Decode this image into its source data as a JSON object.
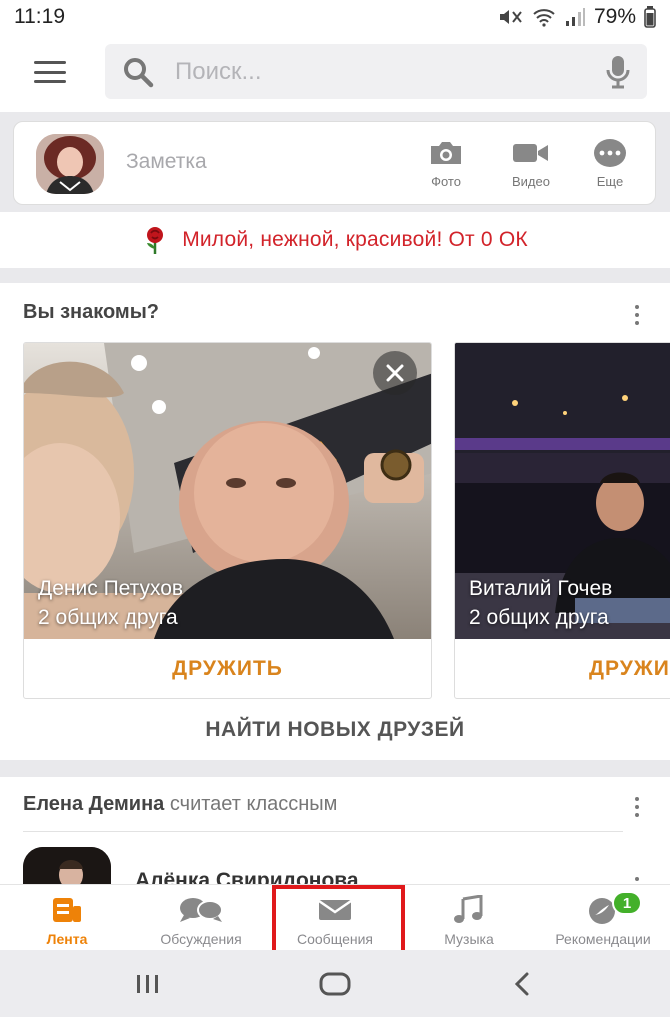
{
  "status": {
    "time": "11:19",
    "battery": "79%"
  },
  "search": {
    "placeholder": "Поиск..."
  },
  "composer": {
    "placeholder": "Заметка",
    "actions": [
      {
        "label": "Фото",
        "icon": "camera-icon"
      },
      {
        "label": "Видео",
        "icon": "video-camera-icon"
      },
      {
        "label": "Еще",
        "icon": "more-icon"
      }
    ]
  },
  "promo": {
    "text": "Милой, нежной, красивой! От 0 ОК",
    "icon": "rose-icon"
  },
  "suggestions": {
    "title": "Вы знакомы?",
    "people": [
      {
        "name": "Денис Петухов",
        "mutual": "2 общих друга",
        "button": "ДРУЖИТЬ"
      },
      {
        "name": "Виталий Гочев",
        "mutual": "2 общих друга",
        "button": "ДРУЖИТЬ"
      }
    ],
    "find_more": "НАЙТИ НОВЫХ ДРУЗЕЙ"
  },
  "feed": {
    "actor": "Елена Демина",
    "action": "считает классным",
    "author": "Алёнка Свиридонова"
  },
  "tabs": [
    {
      "label": "Лента",
      "icon": "feed-icon",
      "active": true
    },
    {
      "label": "Обсуждения",
      "icon": "discussions-icon"
    },
    {
      "label": "Сообщения",
      "icon": "envelope-icon"
    },
    {
      "label": "Музыка",
      "icon": "music-note-icon"
    },
    {
      "label": "Рекомендации",
      "icon": "recommendations-icon",
      "badge": "1"
    }
  ],
  "colors": {
    "accent": "#ee8208",
    "promo_red": "#d2232a",
    "badge_green": "#43b02a",
    "highlight_red": "#e0191b"
  }
}
